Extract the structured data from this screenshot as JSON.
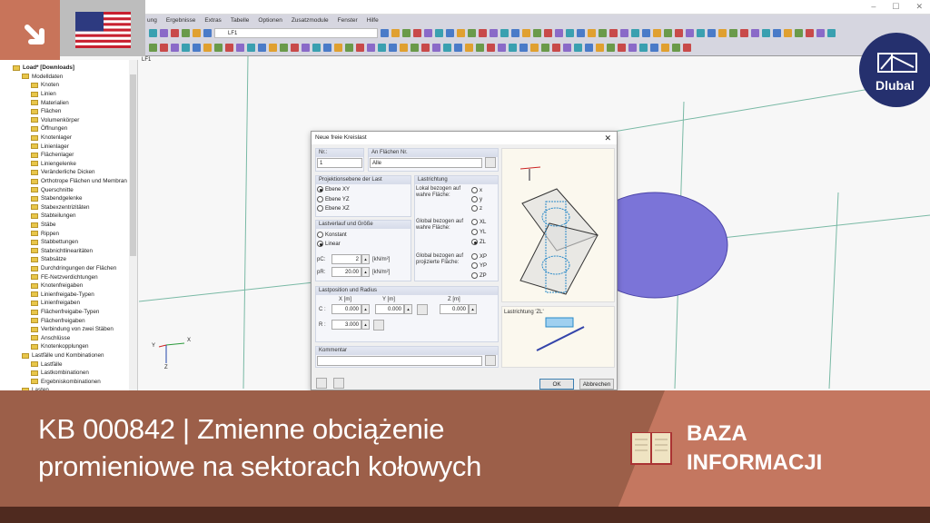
{
  "window": {
    "minimize": "–",
    "maximize": "☐",
    "close": "✕"
  },
  "menu": [
    "ung",
    "Ergebnisse",
    "Extras",
    "Tabelle",
    "Optionen",
    "Zusatzmodule",
    "Fenster",
    "Hilfe"
  ],
  "toolbar": {
    "loadcase": "LF1"
  },
  "tree": {
    "root": "Load* [Downloads]",
    "model": "Modelldaten",
    "model_items": [
      "Knoten",
      "Linien",
      "Materialien",
      "Flächen",
      "Volumenkörper",
      "Öffnungen",
      "Knotenlager",
      "Linienlager",
      "Flächenlager",
      "Liniengelenke",
      "Veränderliche Dicken",
      "Orthotrope Flächen und Membran",
      "Querschnitte",
      "Stabendgelenke",
      "Stabexzentrizitäten",
      "Stabteilungen",
      "Stäbe",
      "Rippen",
      "Stabbettungen",
      "Stabnichtlinearitäten",
      "Stabsätze",
      "Durchdringungen der Flächen",
      "FE-Netzverdichtungen",
      "Knotenfreigaben",
      "Linienfreigabe-Typen",
      "Linienfreigaben",
      "Flächenfreigabe-Typen",
      "Flächenfreigaben",
      "Verbindung von zwei Stäben",
      "Anschlüsse",
      "Knotenkopplungen"
    ],
    "loads": "Lastfälle und Kombinationen",
    "load_items": [
      "Lastfälle",
      "Lastkombinationen",
      "Ergebniskombinationen"
    ],
    "last": "Lasten"
  },
  "canvas": {
    "label": "LF1",
    "axis_x": "X",
    "axis_y": "Y",
    "axis_z": "Z"
  },
  "dialog": {
    "title": "Neue freie Kreislast",
    "close": "✕",
    "nr_label": "Nr.:",
    "nr_value": "1",
    "surfaces_label": "An Flächen Nr.",
    "surfaces_value": "Alle",
    "projection_label": "Projektionsebene der Last",
    "projection_options": [
      "Ebene XY",
      "Ebene YZ",
      "Ebene XZ"
    ],
    "projection_selected": 0,
    "distribution_label": "Lastverlauf und Größe",
    "distribution_options": [
      "Konstant",
      "Linear"
    ],
    "distribution_selected": 1,
    "pc_label": "pC:",
    "pc_value": "2",
    "pc_unit": "[kN/m²]",
    "pr_label": "pR:",
    "pr_value": "20.00",
    "pr_unit": "[kN/m²]",
    "direction_label": "Lastrichtung",
    "local_label": "Lokal bezogen auf wahre Fläche:",
    "local_options": [
      "x",
      "y",
      "z"
    ],
    "global_true_label": "Global bezogen auf wahre Fläche:",
    "global_true_options": [
      "XL",
      "YL",
      "ZL"
    ],
    "global_proj_label": "Global bezogen auf projizierte Fläche:",
    "global_proj_options": [
      "XP",
      "YP",
      "ZP"
    ],
    "direction_selected": "ZL",
    "position_label": "Lastposition und Radius",
    "x_header": "X [m]",
    "y_header": "Y [m]",
    "z_header": "Z [m]",
    "c_label": "C :",
    "cx": "0.000",
    "cy": "0.000",
    "cz": "0.000",
    "r_label": "R :",
    "r_value": "3.000",
    "comment_label": "Kommentar",
    "comment_value": "",
    "preview_caption": "Lastrichtung 'ZL'",
    "ok": "OK",
    "cancel": "Abbrechen"
  },
  "banner": {
    "title_line1": "KB 000842 | Zmienne obciążenie",
    "title_line2": "promieniowe na sektorach kołowych",
    "category_line1": "BAZA",
    "category_line2": "INFORMACJI"
  },
  "logo": {
    "text": "Dlubal"
  },
  "colors": {
    "banner": "#9c5f49",
    "banner_right": "#c47760",
    "bottom": "#4f2a1f",
    "brand": "#c8745a",
    "dlubal": "#25306e",
    "surface": "#7b74d8"
  }
}
